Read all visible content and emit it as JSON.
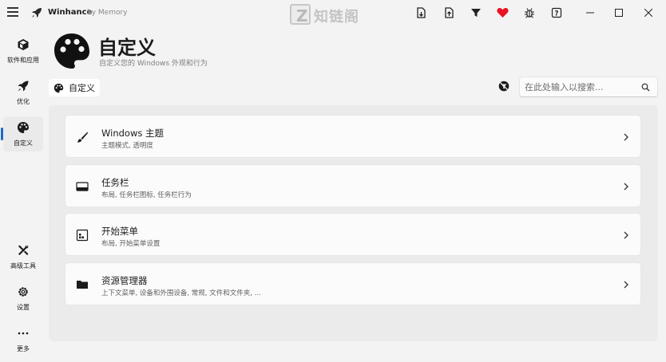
{
  "titlebar": {
    "app_name": "Winhance",
    "by_text": "by Memory",
    "icons": [
      "menu-icon",
      "rocket-icon",
      "export-config-icon",
      "import-config-icon",
      "filter-icon",
      "heart-icon",
      "bug-icon",
      "help-icon"
    ],
    "accent_heart": "#e81224"
  },
  "watermark": {
    "letter": "Z",
    "text": "知链阁"
  },
  "sidebar": {
    "accent": "#1b6ac9",
    "items": [
      {
        "label": "软件和应用",
        "icon": "cube-icon"
      },
      {
        "label": "优化",
        "icon": "rocket-icon"
      },
      {
        "label": "自定义",
        "icon": "palette-icon",
        "active": true
      },
      {
        "label": "高级工具",
        "icon": "tools-icon"
      },
      {
        "label": "设置",
        "icon": "gear-icon"
      },
      {
        "label": "更多",
        "icon": "more-icon"
      }
    ]
  },
  "header": {
    "title": "自定义",
    "subtitle": "自定义您的 Windows 外观和行为"
  },
  "breadcrumb": {
    "label": "自定义"
  },
  "search": {
    "placeholder": "在此处输入以搜索..."
  },
  "cards": [
    {
      "title": "Windows 主题",
      "desc": "主题模式, 透明度",
      "icon": "brush-icon"
    },
    {
      "title": "任务栏",
      "desc": "布局, 任务栏图标, 任务栏行为",
      "icon": "taskbar-icon"
    },
    {
      "title": "开始菜单",
      "desc": "布局, 开始菜单设置",
      "icon": "start-menu-icon"
    },
    {
      "title": "资源管理器",
      "desc": "上下文菜单, 设备和外围设备, 常规, 文件和文件夹, ...",
      "icon": "folder-icon"
    }
  ]
}
